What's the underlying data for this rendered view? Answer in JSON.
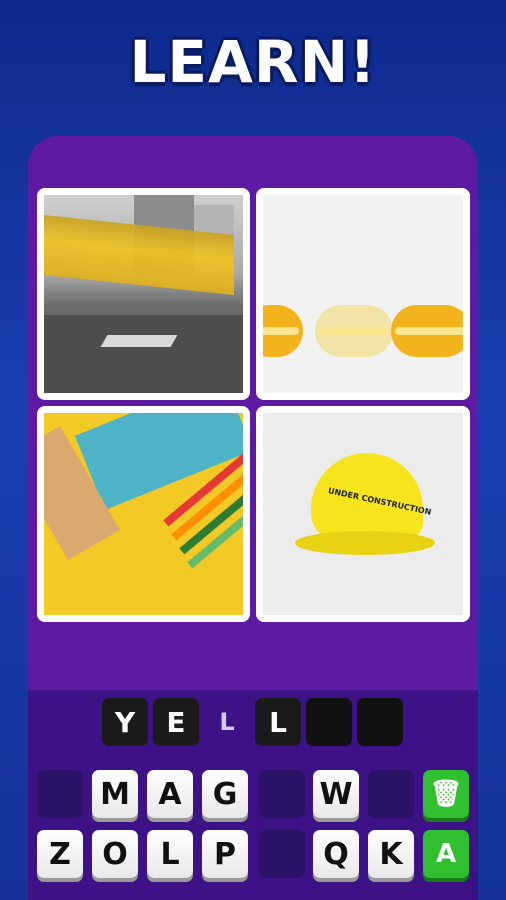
{
  "header": {
    "title": "LEARN!"
  },
  "colors": {
    "background": "#1a3fb0",
    "panel": "#5e1aa3",
    "action_green": "#2fbf2f"
  },
  "pictures": [
    {
      "subject": "yellow tram on street"
    },
    {
      "subject": "yellow macarons"
    },
    {
      "subject": "stationery on yellow"
    },
    {
      "subject": "yellow hard hat",
      "label": "UNDER CONSTRUCTION"
    }
  ],
  "answer": {
    "slots": [
      "Y",
      "E",
      "L",
      "L",
      "",
      ""
    ],
    "hint_index": 2
  },
  "keyboard": {
    "row1": [
      "",
      "M",
      "A",
      "G",
      "",
      "W",
      "",
      "trash-icon"
    ],
    "row2": [
      "Z",
      "O",
      "L",
      "P",
      "",
      "Q",
      "K",
      "hint-icon"
    ],
    "trash_glyph": "🗑",
    "hint_glyph": "A"
  }
}
